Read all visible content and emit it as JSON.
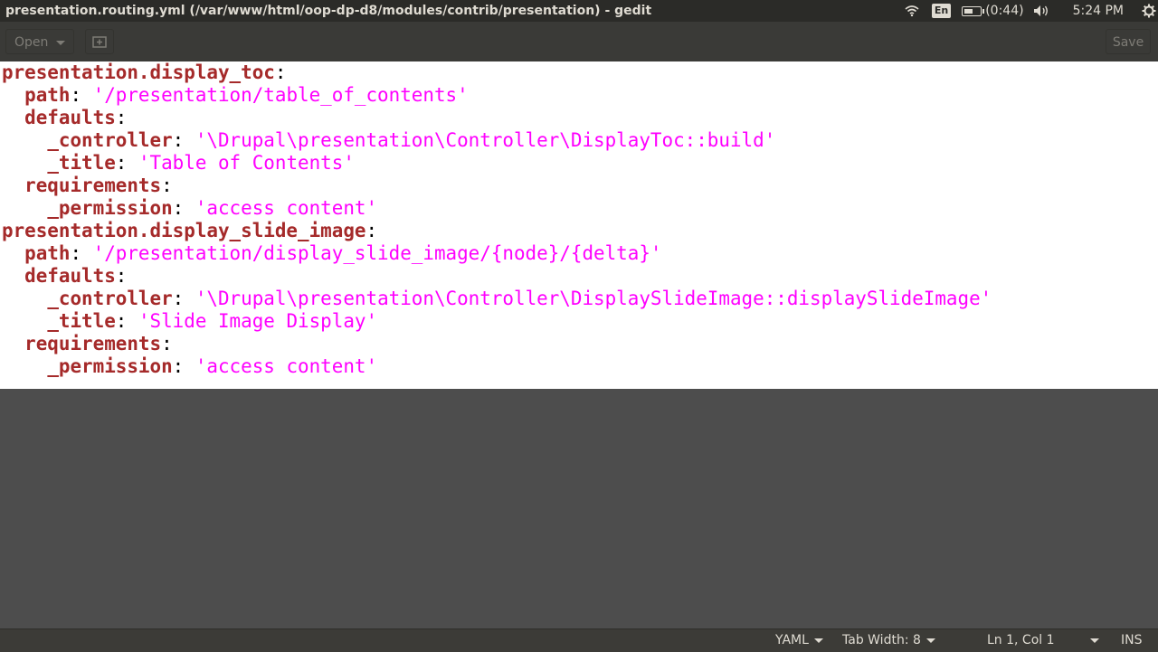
{
  "window": {
    "title": "presentation.routing.yml (/var/www/html/oop-dp-d8/modules/contrib/presentation) - gedit"
  },
  "indicators": {
    "wifi_icon": "wifi-icon",
    "keyboard_lang": "En",
    "battery_icon": "battery-icon",
    "battery_time": "(0:44)",
    "volume_icon": "volume-icon",
    "clock": "5:24 PM",
    "settings_icon": "gear-icon"
  },
  "toolbar": {
    "open_label": "Open",
    "new_tab_icon": "new-tab-icon",
    "save_label": "Save"
  },
  "editor": {
    "lines": [
      {
        "indent": "",
        "key": "presentation.display_toc",
        "value": ""
      },
      {
        "indent": "  ",
        "key": "path",
        "value": "'/presentation/table_of_contents'"
      },
      {
        "indent": "  ",
        "key": "defaults",
        "value": ""
      },
      {
        "indent": "    ",
        "key": "_controller",
        "value": "'\\Drupal\\presentation\\Controller\\DisplayToc::build'"
      },
      {
        "indent": "    ",
        "key": "_title",
        "value": "'Table of Contents'"
      },
      {
        "indent": "  ",
        "key": "requirements",
        "value": ""
      },
      {
        "indent": "    ",
        "key": "_permission",
        "value": "'access content'"
      },
      {
        "indent": "",
        "key": "presentation.display_slide_image",
        "value": ""
      },
      {
        "indent": "  ",
        "key": "path",
        "value": "'/presentation/display_slide_image/{node}/{delta}'"
      },
      {
        "indent": "  ",
        "key": "defaults",
        "value": ""
      },
      {
        "indent": "    ",
        "key": "_controller",
        "value": "'\\Drupal\\presentation\\Controller\\DisplaySlideImage::displaySlideImage'"
      },
      {
        "indent": "    ",
        "key": "_title",
        "value": "'Slide Image Display'"
      },
      {
        "indent": "  ",
        "key": "requirements",
        "value": ""
      },
      {
        "indent": "    ",
        "key": "_permission",
        "value": "'access content'"
      }
    ],
    "colors": {
      "key": "#a52a2a",
      "string": "#ff00ff",
      "background": "#ffffff"
    }
  },
  "statusbar": {
    "language": "YAML",
    "tab_width": "Tab Width: 8",
    "position": "Ln 1, Col 1",
    "mode": "INS"
  }
}
